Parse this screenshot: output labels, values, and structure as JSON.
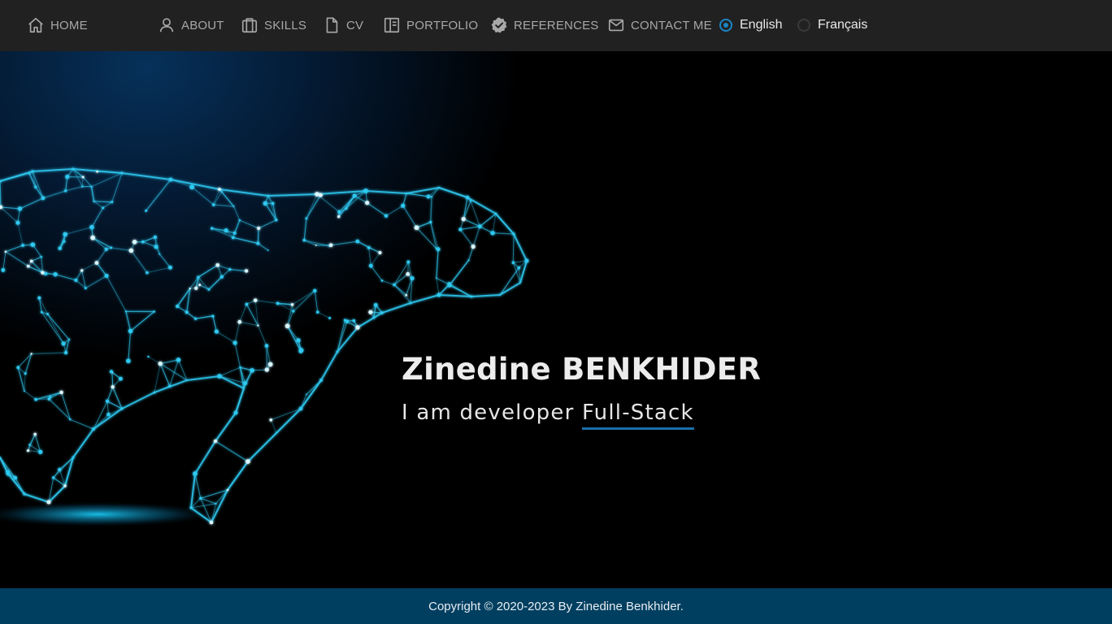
{
  "nav": {
    "home": "HOME",
    "about": "ABOUT",
    "skills": "SKILLS",
    "cv": "CV",
    "portfolio": "PORTFOLIO",
    "references": "REFERENCES",
    "contact": "CONTACT ME"
  },
  "language": {
    "options": [
      "English",
      "Français"
    ],
    "selected": "English"
  },
  "hero": {
    "name": "Zinedine BENKHIDER",
    "tagline_prefix": "I am developer",
    "tagline_typed": "Full-Stack"
  },
  "footer": {
    "copyright": "Copyright © 2020-2023 By Zinedine Benkhider."
  },
  "colors": {
    "topbar": "#212121",
    "accent": "#1a86c4",
    "footer": "#013f60",
    "network": "#2ec8f0"
  },
  "icons": [
    "home-icon",
    "user-icon",
    "briefcase-icon",
    "file-icon",
    "book-icon",
    "badge-check-icon",
    "mail-icon"
  ]
}
